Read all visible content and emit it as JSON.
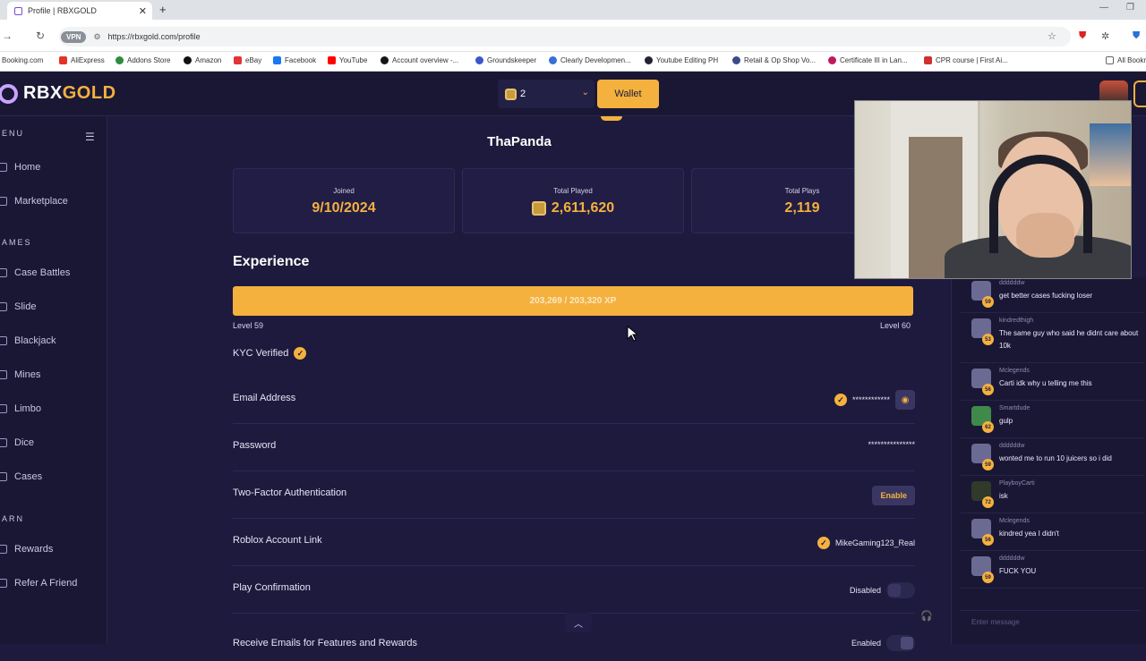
{
  "browser": {
    "tab_title": "Profile | RBXGOLD",
    "url": "https://rbxgold.com/profile",
    "vpn_label": "VPN",
    "bookmarks": [
      "Booking.com",
      "AliExpress",
      "Addons Store",
      "Amazon",
      "eBay",
      "Facebook",
      "YouTube",
      "Account overview -...",
      "Groundskeeper",
      "Clearly Developmen...",
      "Youtube Editing PH",
      "Retail & Op Shop Vo...",
      "Certificate III in Lan...",
      "CPR course | First Ai...",
      "All Bookm"
    ]
  },
  "topbar": {
    "logo_prefix": "RBX",
    "logo_suffix": "GOLD",
    "balance": "2",
    "wallet_label": "Wallet"
  },
  "sidebar": {
    "menu_label": "ENU",
    "games_label": "AMES",
    "earn_label": "ARN",
    "items": [
      {
        "label": "Home",
        "icon": "home-icon"
      },
      {
        "label": "Marketplace",
        "icon": "marketplace-icon"
      },
      {
        "label": "Case Battles",
        "icon": "swords-icon"
      },
      {
        "label": "Slide",
        "icon": "slide-icon"
      },
      {
        "label": "Blackjack",
        "icon": "cards-icon"
      },
      {
        "label": "Mines",
        "icon": "mine-icon"
      },
      {
        "label": "Limbo",
        "icon": "limbo-icon"
      },
      {
        "label": "Dice",
        "icon": "dice-icon"
      },
      {
        "label": "Cases",
        "icon": "case-icon"
      },
      {
        "label": "Rewards",
        "icon": "gift-icon"
      },
      {
        "label": "Refer A Friend",
        "icon": "users-icon"
      }
    ]
  },
  "profile": {
    "username": "ThaPanda",
    "stats": [
      {
        "label": "Joined",
        "value": "9/10/2024"
      },
      {
        "label": "Total Played",
        "value": "2,611,620"
      },
      {
        "label": "Total Plays",
        "value": "2,119"
      }
    ],
    "experience_title": "Experience",
    "xp_text": "203,269 / 203,320 XP",
    "xp_progress": 0.9997,
    "level_current": "Level 59",
    "level_next": "Level 60",
    "kyc_label": "KYC Verified"
  },
  "settings": {
    "email": {
      "label": "Email Address",
      "value": "************"
    },
    "password": {
      "label": "Password",
      "value": "***************"
    },
    "twofa": {
      "label": "Two-Factor Authentication",
      "button": "Enable"
    },
    "roblox": {
      "label": "Roblox Account Link",
      "value": "MikeGaming123_Real"
    },
    "play_confirm": {
      "label": "Play Confirmation",
      "status": "Disabled"
    },
    "emails": {
      "label": "Receive Emails for Features and Rewards",
      "status": "Enabled"
    }
  },
  "chat": {
    "messages": [
      {
        "user": "ddddddw",
        "level": "59",
        "text": "get better cases fucking loser"
      },
      {
        "user": "kindredthigh",
        "level": "53",
        "text": "The same guy who said he didnt care about 10k"
      },
      {
        "user": "Mclegends",
        "level": "56",
        "text": "Carti idk why u telling me this"
      },
      {
        "user": "Smartdude",
        "level": "62",
        "text": "gulp"
      },
      {
        "user": "ddddddw",
        "level": "59",
        "text": "wonted me to run 10 juicers so i did"
      },
      {
        "user": "PlayboyCarti",
        "level": "72",
        "text": "isk"
      },
      {
        "user": "Mclegends",
        "level": "56",
        "text": "kindred yea I didn't"
      },
      {
        "user": "ddddddw",
        "level": "59",
        "text": "FUCK YOU"
      }
    ],
    "input_placeholder": "Enter message"
  }
}
